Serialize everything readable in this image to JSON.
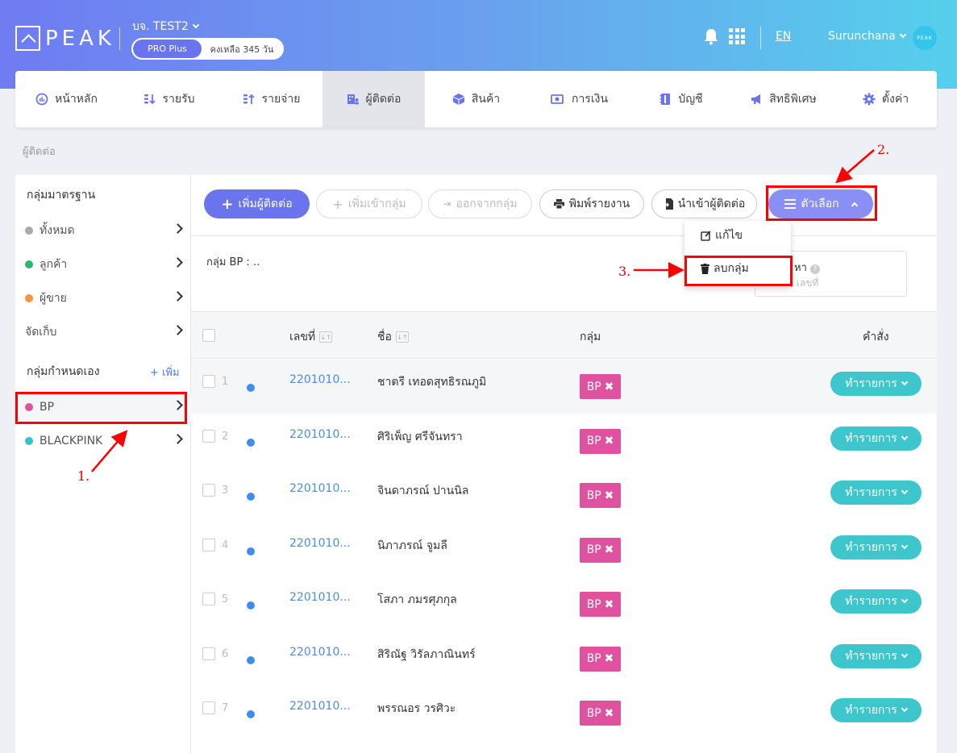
{
  "header": {
    "logo_text": "PEAK",
    "company": "บจ. TEST2",
    "plan": "PRO Plus",
    "days_left": "คงเหลือ 345 วัน",
    "lang": "EN",
    "user": "Surunchana",
    "avatar_text": "PEAK"
  },
  "nav": {
    "items": [
      {
        "label": "หน้าหลัก",
        "icon": "dashboard-icon"
      },
      {
        "label": "รายรับ",
        "icon": "income-icon"
      },
      {
        "label": "รายจ่าย",
        "icon": "expense-icon"
      },
      {
        "label": "ผู้ติดต่อ",
        "icon": "contacts-icon"
      },
      {
        "label": "สินค้า",
        "icon": "box-icon"
      },
      {
        "label": "การเงิน",
        "icon": "money-icon"
      },
      {
        "label": "บัญชี",
        "icon": "book-icon"
      },
      {
        "label": "สิทธิพิเศษ",
        "icon": "megaphone-icon"
      },
      {
        "label": "ตั้งค่า",
        "icon": "gear-icon"
      }
    ],
    "active": "ผู้ติดต่อ"
  },
  "breadcrumb": "ผู้ติดต่อ",
  "sidebar": {
    "standard_title": "กลุ่มมาตรฐาน",
    "standard": [
      {
        "label": "ทั้งหมด",
        "color": "#aaaaaa"
      },
      {
        "label": "ลูกค้า",
        "color": "#2bb673"
      },
      {
        "label": "ผู้ขาย",
        "color": "#f7943d"
      },
      {
        "label": "จัดเก็บ",
        "color": ""
      }
    ],
    "custom_title": "กลุ่มกำหนดเอง",
    "add_label": "+ เพิ่ม",
    "custom": [
      {
        "label": "BP",
        "color": "#e0529f"
      },
      {
        "label": "BLACKPINK",
        "color": "#2ec4c8"
      }
    ]
  },
  "toolbar": {
    "add_contact": "เพิ่มผู้ติดต่อ",
    "add_to_group": "เพิ่มเข้ากลุ่ม",
    "remove_from_group": "ออกจากกลุ่ม",
    "print_report": "พิมพ์รายงาน",
    "import_contacts": "นำเข้าผู้ติดต่อ",
    "options": "ตัวเลือก"
  },
  "dropdown": {
    "edit": "แก้ไข",
    "delete_group": "ลบกลุ่ม"
  },
  "group_label": "กลุ่ม BP : ..",
  "search": {
    "label": "หา",
    "placeholder": "วยชื่อ, เลขที่"
  },
  "table": {
    "headers": {
      "number": "เลขที่",
      "name": "ชื่อ",
      "group": "กลุ่ม",
      "action": "คำสั่ง"
    },
    "rows": [
      {
        "idx": "1",
        "code": "2201010...",
        "name": "ชาตรี เทอดสุทธิรณภูมิ",
        "tag": "BP",
        "action": "ทำรายการ"
      },
      {
        "idx": "2",
        "code": "2201010...",
        "name": "ศิริเพ็ญ ศรีจันทรา",
        "tag": "BP",
        "action": "ทำรายการ"
      },
      {
        "idx": "3",
        "code": "2201010...",
        "name": "จินดาภรณ์ ปานนิล",
        "tag": "BP",
        "action": "ทำรายการ"
      },
      {
        "idx": "4",
        "code": "2201010...",
        "name": "นิภาภรณ์ จูมลี",
        "tag": "BP",
        "action": "ทำรายการ"
      },
      {
        "idx": "5",
        "code": "2201010...",
        "name": "โสภา ภมรศุภกุล",
        "tag": "BP",
        "action": "ทำรายการ"
      },
      {
        "idx": "6",
        "code": "2201010...",
        "name": "สิริณัฐ วิรัลภาณินทร์",
        "tag": "BP",
        "action": "ทำรายการ"
      },
      {
        "idx": "7",
        "code": "2201010...",
        "name": "พรรณอร วรศิวะ",
        "tag": "BP",
        "action": "ทำรายการ"
      }
    ]
  },
  "annotations": {
    "step1": "1.",
    "step2": "2.",
    "step3": "3."
  },
  "colors": {
    "primary": "#6b74ef",
    "teal": "#3dc6cc",
    "pink": "#e0529f",
    "link": "#4a8de8",
    "annotation": "#ff0000"
  }
}
